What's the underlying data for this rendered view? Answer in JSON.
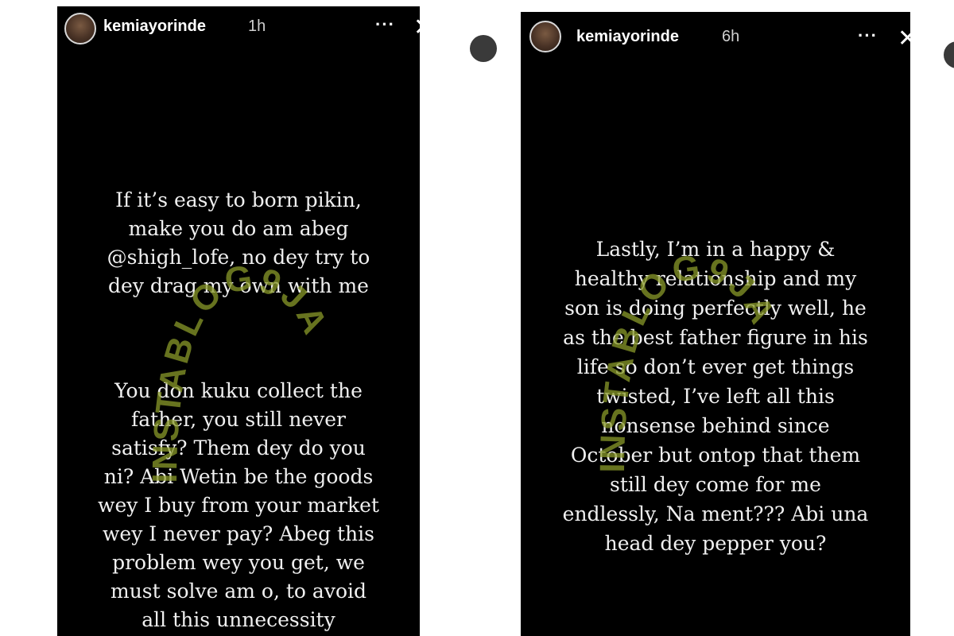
{
  "stories": [
    {
      "username": "kemiayorinde",
      "time": "1h",
      "more_label": "···",
      "close_label": "✕",
      "paragraphs": [
        "If it’s easy to born pikin,\nmake you do am abeg\n@shigh_lofe, no dey try to\ndey drag my own with me",
        "You don kuku collect the\nfather, you still never\nsatisfy? Them dey do you\nni? Abi Wetin be the goods\nwey I buy from your market\nwey I never pay? Abeg this\nproblem wey you get, we\nmust solve am o, to avoid\nall this unnecessity"
      ]
    },
    {
      "username": "kemiayorinde",
      "time": "6h",
      "more_label": "···",
      "close_label": "✕",
      "paragraphs": [
        "Lastly, I’m in a happy &\nhealthy relationship and my\nson is doing perfectly well, he\nas the best father figure in his\nlife so don’t ever get things\ntwisted, I’ve left all this\nnonsense behind since\nOctober but ontop that them\nstill dey come for me\nendlessly, Na ment??? Abi una\nhead dey pepper you?"
      ]
    }
  ],
  "watermark": {
    "text": "INSTABLOG9JA",
    "color": "#8a9a2a"
  }
}
